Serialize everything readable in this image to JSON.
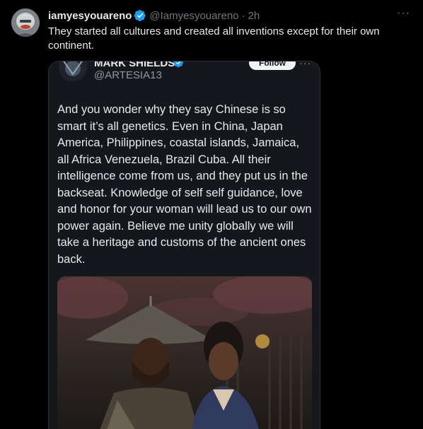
{
  "tweet": {
    "display_name": "iamyesyouareno",
    "handle": "@Iamyesyouareno",
    "separator": "·",
    "time": "2h",
    "more_icon": "more-horizontal-icon",
    "text": "They started all cultures and created all inventions except for their own continent."
  },
  "embedded": {
    "display_name": "MARK SHIELDS",
    "handle": "@ARTESIA13",
    "follow_label": "Follow",
    "body": "And you wonder why they say Chinese is so smart it’s all genetics. Even in China, Japan America, Philippines, coastal islands, Jamaica, all Africa Venezuela, Brazil Cuba. All their intelligence come from us, and they put us in the backseat. Knowledge of self self guidance, love and honor for your woman will lead us to our own power again. Believe me unity globally we will take a heritage and customs of the ancient ones back."
  },
  "colors": {
    "background": "#000000",
    "text": "#e7e9ea",
    "secondary": "#71767b",
    "verified": "#1d9bf0",
    "card": "#14171c"
  }
}
